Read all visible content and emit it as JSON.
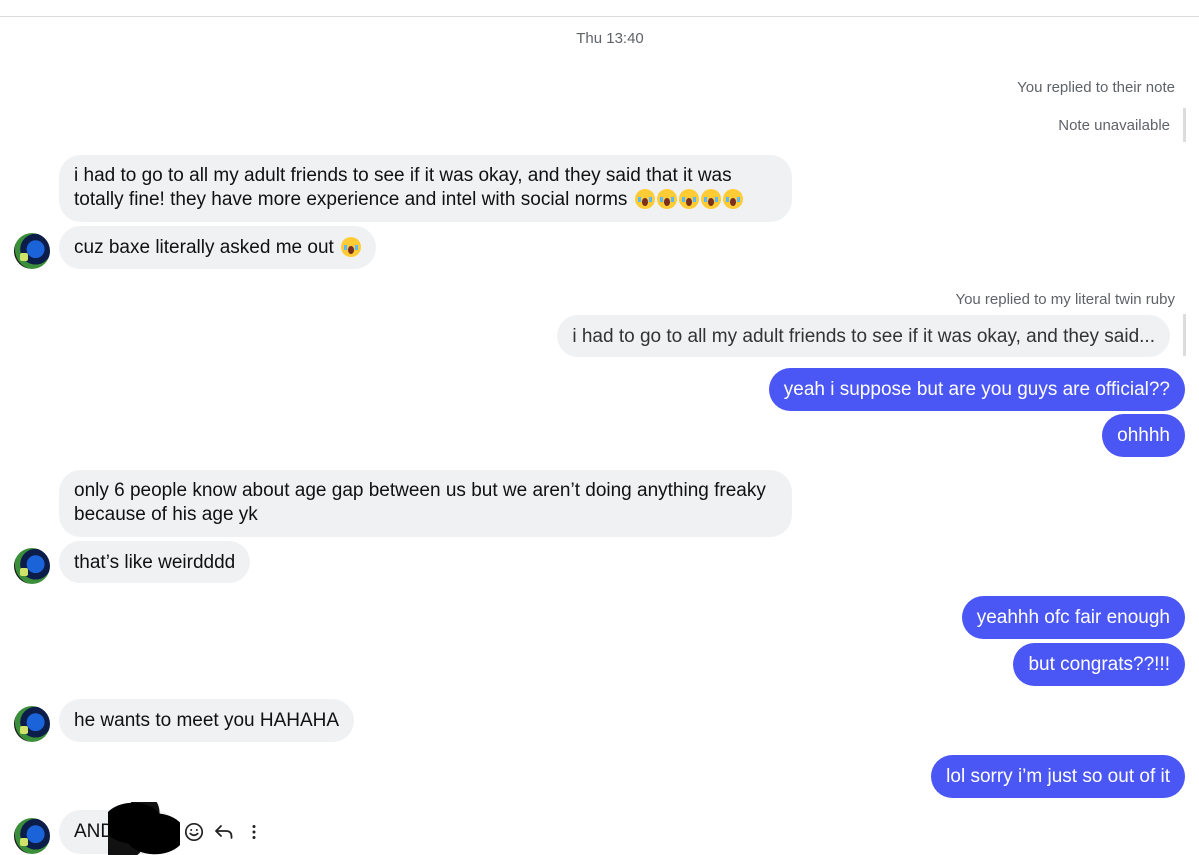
{
  "timestamp": "Thu 13:40",
  "note_reply": {
    "label": "You replied to their note",
    "note_text": "Note unavailable"
  },
  "messages": [
    {
      "from": "them",
      "text": "i had to go to all my adult friends to see if it was okay, and they said that it was totally fine! they have more experience and intel with social norms",
      "line1": "i had to go to all my adult friends to see if it was okay, and they said that it was",
      "line2": "totally fine! they have more experience and intel with social norms",
      "emoji_count": 5,
      "emoji": "crying-face"
    },
    {
      "from": "them",
      "text": "cuz baxe literally asked me out",
      "emoji_count": 1,
      "emoji": "crying-face"
    },
    {
      "from": "me",
      "reply_label": "You replied to my literal twin ruby",
      "quoted_text": "i had to go to all my adult friends to see if it was okay, and they said..."
    },
    {
      "from": "me",
      "text": "yeah i suppose but are you guys are official??"
    },
    {
      "from": "me",
      "text": "ohhhh"
    },
    {
      "from": "them",
      "line1": "only 6 people know about age gap between us but we aren’t doing anything freaky",
      "line2": "because of his age yk"
    },
    {
      "from": "them",
      "text": "that’s like weirdddd"
    },
    {
      "from": "me",
      "text": "yeahhh ofc fair enough"
    },
    {
      "from": "me",
      "text": "but congrats??!!!"
    },
    {
      "from": "them",
      "text": "he wants to meet you HAHAHA"
    },
    {
      "from": "me",
      "text": "lol sorry i’m just so out of it"
    },
    {
      "from": "them",
      "text": "AND"
    }
  ],
  "message_actions": [
    "react-icon",
    "reply-icon",
    "more-icon"
  ],
  "colors": {
    "outgoing_bubble": "#4b57f5",
    "incoming_bubble": "#f0f1f3",
    "meta_text": "#5f6368"
  }
}
